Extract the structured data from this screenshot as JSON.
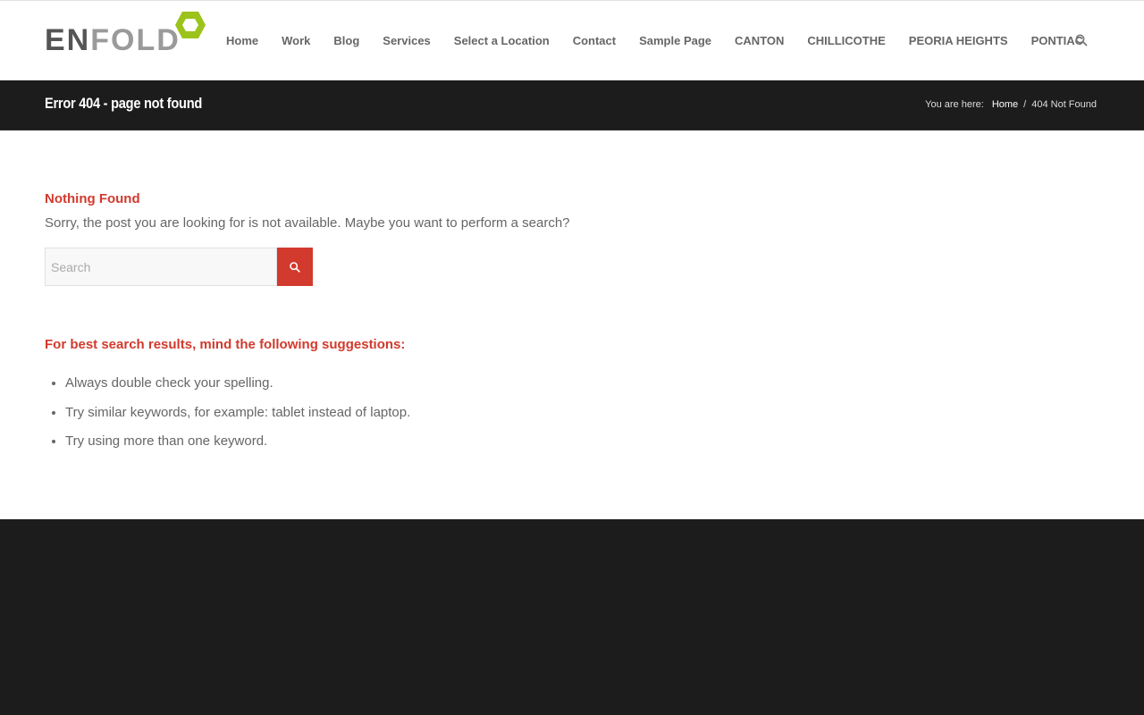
{
  "logo": {
    "part1": "EN",
    "part2": "FOLD",
    "accent_color": "#9cc31b"
  },
  "nav": {
    "items": [
      "Home",
      "Work",
      "Blog",
      "Services",
      "Select a Location",
      "Contact",
      "Sample Page",
      "CANTON",
      "CHILLICOTHE",
      "PEORIA HEIGHTS",
      "PONTIAC"
    ],
    "search_icon": "search-icon"
  },
  "titlebar": {
    "title": "Error 404 - page not found",
    "breadcrumb_label": "You are here:",
    "breadcrumb_home": "Home",
    "breadcrumb_sep": "/",
    "breadcrumb_current": "404 Not Found"
  },
  "content": {
    "heading": "Nothing Found",
    "text": "Sorry, the post you are looking for is not available. Maybe you want to perform a search?",
    "search_placeholder": "Search",
    "suggestions_heading": "For best search results, mind the following suggestions:",
    "suggestions": [
      "Always double check your spelling.",
      "Try similar keywords, for example: tablet instead of laptop.",
      "Try using more than one keyword."
    ]
  },
  "colors": {
    "accent": "#d13a2d",
    "dark": "#1c1c1c",
    "text": "#666666"
  }
}
